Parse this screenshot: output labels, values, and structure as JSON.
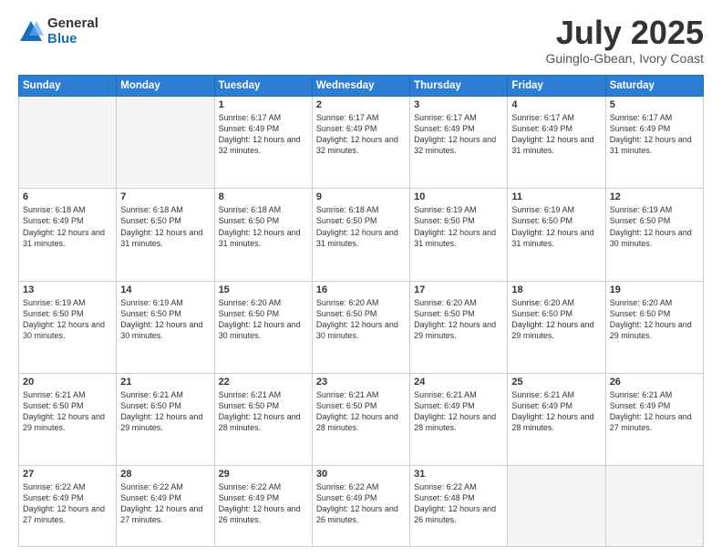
{
  "header": {
    "logo": {
      "general": "General",
      "blue": "Blue"
    },
    "title": "July 2025",
    "subtitle": "Guinglo-Gbean, Ivory Coast"
  },
  "calendar": {
    "days_of_week": [
      "Sunday",
      "Monday",
      "Tuesday",
      "Wednesday",
      "Thursday",
      "Friday",
      "Saturday"
    ],
    "weeks": [
      [
        {
          "day": "",
          "info": ""
        },
        {
          "day": "",
          "info": ""
        },
        {
          "day": "1",
          "info": "Sunrise: 6:17 AM\nSunset: 6:49 PM\nDaylight: 12 hours and 32 minutes."
        },
        {
          "day": "2",
          "info": "Sunrise: 6:17 AM\nSunset: 6:49 PM\nDaylight: 12 hours and 32 minutes."
        },
        {
          "day": "3",
          "info": "Sunrise: 6:17 AM\nSunset: 6:49 PM\nDaylight: 12 hours and 32 minutes."
        },
        {
          "day": "4",
          "info": "Sunrise: 6:17 AM\nSunset: 6:49 PM\nDaylight: 12 hours and 31 minutes."
        },
        {
          "day": "5",
          "info": "Sunrise: 6:17 AM\nSunset: 6:49 PM\nDaylight: 12 hours and 31 minutes."
        }
      ],
      [
        {
          "day": "6",
          "info": "Sunrise: 6:18 AM\nSunset: 6:49 PM\nDaylight: 12 hours and 31 minutes."
        },
        {
          "day": "7",
          "info": "Sunrise: 6:18 AM\nSunset: 6:50 PM\nDaylight: 12 hours and 31 minutes."
        },
        {
          "day": "8",
          "info": "Sunrise: 6:18 AM\nSunset: 6:50 PM\nDaylight: 12 hours and 31 minutes."
        },
        {
          "day": "9",
          "info": "Sunrise: 6:18 AM\nSunset: 6:50 PM\nDaylight: 12 hours and 31 minutes."
        },
        {
          "day": "10",
          "info": "Sunrise: 6:19 AM\nSunset: 6:50 PM\nDaylight: 12 hours and 31 minutes."
        },
        {
          "day": "11",
          "info": "Sunrise: 6:19 AM\nSunset: 6:50 PM\nDaylight: 12 hours and 31 minutes."
        },
        {
          "day": "12",
          "info": "Sunrise: 6:19 AM\nSunset: 6:50 PM\nDaylight: 12 hours and 30 minutes."
        }
      ],
      [
        {
          "day": "13",
          "info": "Sunrise: 6:19 AM\nSunset: 6:50 PM\nDaylight: 12 hours and 30 minutes."
        },
        {
          "day": "14",
          "info": "Sunrise: 6:19 AM\nSunset: 6:50 PM\nDaylight: 12 hours and 30 minutes."
        },
        {
          "day": "15",
          "info": "Sunrise: 6:20 AM\nSunset: 6:50 PM\nDaylight: 12 hours and 30 minutes."
        },
        {
          "day": "16",
          "info": "Sunrise: 6:20 AM\nSunset: 6:50 PM\nDaylight: 12 hours and 30 minutes."
        },
        {
          "day": "17",
          "info": "Sunrise: 6:20 AM\nSunset: 6:50 PM\nDaylight: 12 hours and 29 minutes."
        },
        {
          "day": "18",
          "info": "Sunrise: 6:20 AM\nSunset: 6:50 PM\nDaylight: 12 hours and 29 minutes."
        },
        {
          "day": "19",
          "info": "Sunrise: 6:20 AM\nSunset: 6:50 PM\nDaylight: 12 hours and 29 minutes."
        }
      ],
      [
        {
          "day": "20",
          "info": "Sunrise: 6:21 AM\nSunset: 6:50 PM\nDaylight: 12 hours and 29 minutes."
        },
        {
          "day": "21",
          "info": "Sunrise: 6:21 AM\nSunset: 6:50 PM\nDaylight: 12 hours and 29 minutes."
        },
        {
          "day": "22",
          "info": "Sunrise: 6:21 AM\nSunset: 6:50 PM\nDaylight: 12 hours and 28 minutes."
        },
        {
          "day": "23",
          "info": "Sunrise: 6:21 AM\nSunset: 6:50 PM\nDaylight: 12 hours and 28 minutes."
        },
        {
          "day": "24",
          "info": "Sunrise: 6:21 AM\nSunset: 6:49 PM\nDaylight: 12 hours and 28 minutes."
        },
        {
          "day": "25",
          "info": "Sunrise: 6:21 AM\nSunset: 6:49 PM\nDaylight: 12 hours and 28 minutes."
        },
        {
          "day": "26",
          "info": "Sunrise: 6:21 AM\nSunset: 6:49 PM\nDaylight: 12 hours and 27 minutes."
        }
      ],
      [
        {
          "day": "27",
          "info": "Sunrise: 6:22 AM\nSunset: 6:49 PM\nDaylight: 12 hours and 27 minutes."
        },
        {
          "day": "28",
          "info": "Sunrise: 6:22 AM\nSunset: 6:49 PM\nDaylight: 12 hours and 27 minutes."
        },
        {
          "day": "29",
          "info": "Sunrise: 6:22 AM\nSunset: 6:49 PM\nDaylight: 12 hours and 26 minutes."
        },
        {
          "day": "30",
          "info": "Sunrise: 6:22 AM\nSunset: 6:49 PM\nDaylight: 12 hours and 26 minutes."
        },
        {
          "day": "31",
          "info": "Sunrise: 6:22 AM\nSunset: 6:48 PM\nDaylight: 12 hours and 26 minutes."
        },
        {
          "day": "",
          "info": ""
        },
        {
          "day": "",
          "info": ""
        }
      ]
    ]
  }
}
